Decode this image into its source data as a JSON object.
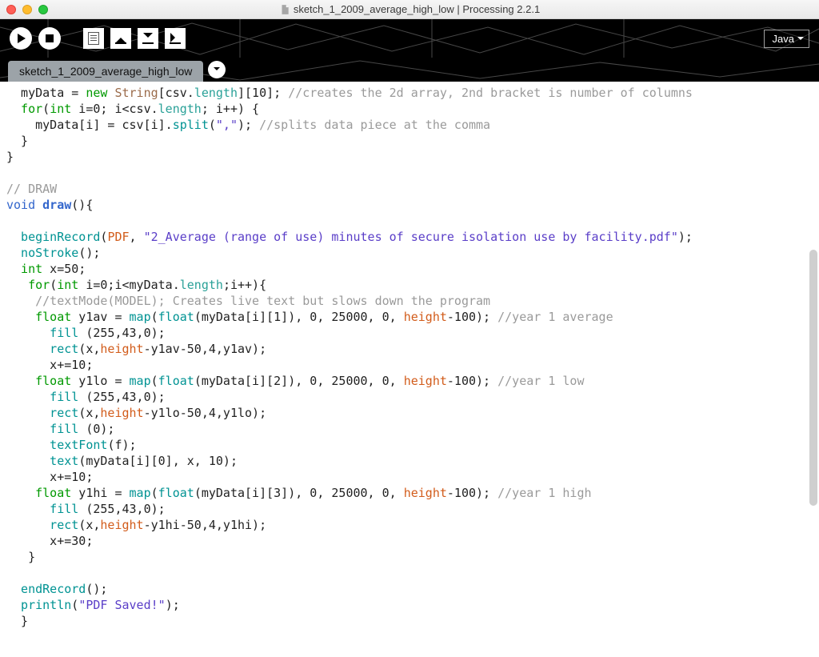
{
  "window": {
    "title": "sketch_1_2009_average_high_low | Processing 2.2.1"
  },
  "toolbar": {
    "run": "Run",
    "stop": "Stop",
    "newfile": "New",
    "open": "Open",
    "save": "Save",
    "export": "Export",
    "mode": "Java"
  },
  "tabs": {
    "active": "sketch_1_2009_average_high_low"
  },
  "code": {
    "l1": {
      "a": "  myData = ",
      "b": "new",
      "c": " String",
      "d": "[csv.",
      "e": "length",
      "f": "][10]; ",
      "g": "//creates the 2d array, 2nd bracket is number of columns"
    },
    "l2": {
      "a": "  for",
      "b": "(",
      "c": "int",
      "d": " i=0; i<csv.",
      "e": "length",
      "f": "; i++) {"
    },
    "l3": {
      "a": "    myData[i] = csv[i].",
      "b": "split",
      "c": "(",
      "d": "\",\"",
      "e": "); ",
      "f": "//splits data piece at the comma"
    },
    "l4": "  }",
    "l5": "}",
    "l6": "",
    "l7": {
      "a": "// DRAW"
    },
    "l8": {
      "a": "void",
      "b": " draw",
      "c": "(){"
    },
    "l9": "",
    "l10": {
      "a": "  beginRecord",
      "b": "(",
      "c": "PDF",
      "d": ", ",
      "e": "\"2_Average (range of use) minutes of secure isolation use by facility.pdf\"",
      "f": ");"
    },
    "l11": {
      "a": "  noStroke",
      "b": "();"
    },
    "l12": {
      "a": "  int",
      "b": " x=50;"
    },
    "l13": {
      "a": "   for",
      "b": "(",
      "c": "int",
      "d": " i=0;i<myData.",
      "e": "length",
      "f": ";i++){"
    },
    "l14": {
      "a": "    //textMode(MODEL); Creates live text but slows down the program"
    },
    "l15": {
      "a": "    float",
      "b": " y1av = ",
      "c": "map",
      "d": "(",
      "e": "float",
      "f": "(myData[i][1]), 0, 25000, 0, ",
      "g": "height",
      "h": "-100); ",
      "i": "//year 1 average"
    },
    "l16": {
      "a": "      fill",
      "b": " (255,43,0);"
    },
    "l17": {
      "a": "      rect",
      "b": "(x,",
      "c": "height",
      "d": "-y1av-50,4,y1av);"
    },
    "l18": "      x+=10;",
    "l19": {
      "a": "    float",
      "b": " y1lo = ",
      "c": "map",
      "d": "(",
      "e": "float",
      "f": "(myData[i][2]), 0, 25000, 0, ",
      "g": "height",
      "h": "-100); ",
      "i": "//year 1 low"
    },
    "l20": {
      "a": "      fill",
      "b": " (255,43,0);"
    },
    "l21": {
      "a": "      rect",
      "b": "(x,",
      "c": "height",
      "d": "-y1lo-50,4,y1lo);"
    },
    "l22": {
      "a": "      fill",
      "b": " (0);"
    },
    "l23": {
      "a": "      textFont",
      "b": "(f);"
    },
    "l24": {
      "a": "      text",
      "b": "(myData[i][0], x, 10);"
    },
    "l25": "      x+=10;",
    "l26": {
      "a": "    float",
      "b": " y1hi = ",
      "c": "map",
      "d": "(",
      "e": "float",
      "f": "(myData[i][3]), 0, 25000, 0, ",
      "g": "height",
      "h": "-100); ",
      "i": "//year 1 high"
    },
    "l27": {
      "a": "      fill",
      "b": " (255,43,0);"
    },
    "l28": {
      "a": "      rect",
      "b": "(x,",
      "c": "height",
      "d": "-y1hi-50,4,y1hi);"
    },
    "l29": "      x+=30;",
    "l30": "   }",
    "l31": "",
    "l32": {
      "a": "  endRecord",
      "b": "();"
    },
    "l33": {
      "a": "  println",
      "b": "(",
      "c": "\"PDF Saved!\"",
      "d": ");"
    },
    "l34": "  }"
  }
}
